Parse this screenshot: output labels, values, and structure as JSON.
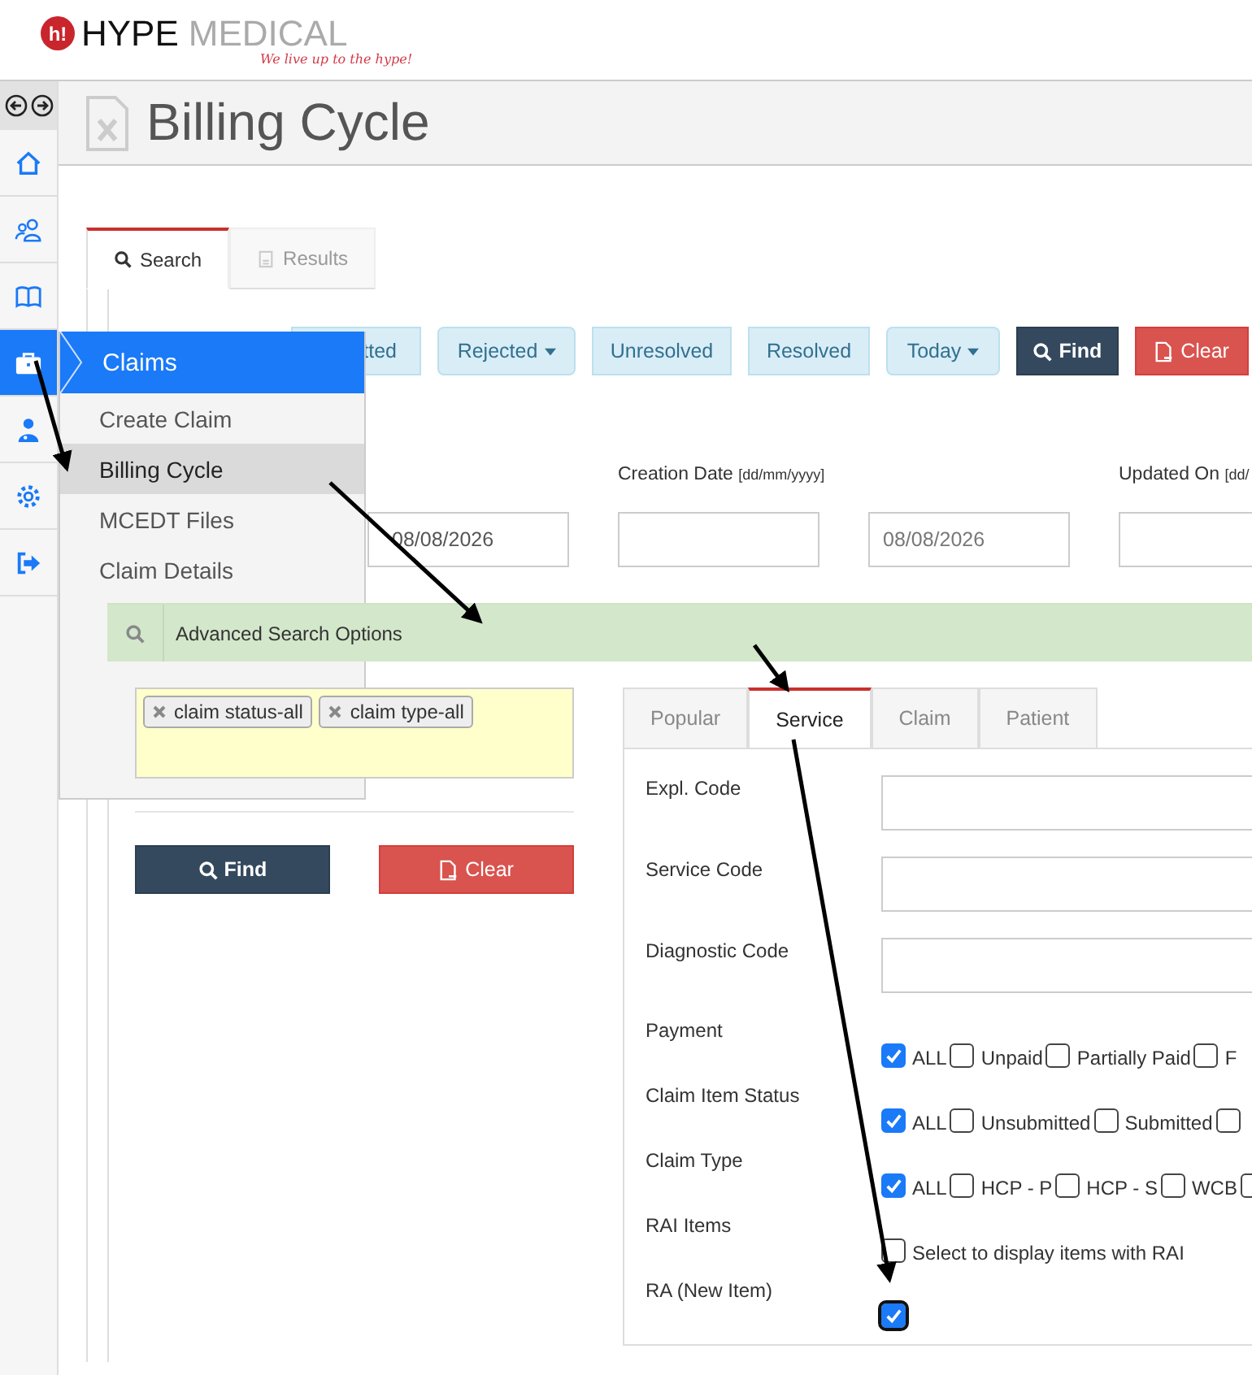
{
  "header": {
    "logo_mark": "h!",
    "brand": "HYPE",
    "brand_suffix": "MEDICAL",
    "tagline": "We live up to the hype!"
  },
  "sidebar": {
    "items": [
      {
        "kind": "home",
        "selected": false
      },
      {
        "kind": "users",
        "selected": false
      },
      {
        "kind": "book",
        "selected": false
      },
      {
        "kind": "briefcase",
        "selected": true
      },
      {
        "kind": "doctor",
        "selected": false
      },
      {
        "kind": "gear",
        "selected": false
      },
      {
        "kind": "signout",
        "selected": false
      }
    ]
  },
  "page_title": "Billing Cycle",
  "tabs": [
    {
      "label": "Search",
      "selected": true,
      "disabled": false
    },
    {
      "label": "Results",
      "selected": false,
      "disabled": true
    }
  ],
  "filter_buttons": [
    {
      "label": "tted",
      "kind": "toggle"
    },
    {
      "label": "Rejected",
      "kind": "dropdown"
    },
    {
      "label": "Unresolved",
      "kind": "toggle"
    },
    {
      "label": "Resolved",
      "kind": "toggle"
    },
    {
      "label": "Today",
      "kind": "dropdown"
    },
    {
      "label": "Find",
      "kind": "find"
    },
    {
      "label": "Clear",
      "kind": "clear"
    }
  ],
  "date_filters": [
    {
      "inputs": [
        {
          "kind": "date",
          "value": "08/08/2026"
        }
      ]
    },
    {
      "label": "Creation Date",
      "hint": "[dd/mm/yyyy]",
      "inputs": [
        {
          "kind": "date"
        },
        {
          "kind": "date",
          "value": "08/08/2026"
        }
      ]
    },
    {
      "label": "Updated On",
      "hint": "[dd/",
      "inputs": [
        {
          "kind": "date"
        }
      ]
    }
  ],
  "menu": {
    "title": "Claims",
    "items": [
      {
        "label": "Create Claim",
        "selected": false
      },
      {
        "label": "Billing Cycle",
        "selected": true
      },
      {
        "label": "MCEDT Files",
        "selected": false
      },
      {
        "label": "Claim Details",
        "selected": false
      }
    ]
  },
  "advanced": {
    "title": "Advanced Search Options",
    "tags": [
      "claim status-all",
      "claim type-all"
    ],
    "buttons": [
      {
        "label": "Find",
        "kind": "find"
      },
      {
        "label": "Clear",
        "kind": "clear"
      }
    ],
    "tabs": [
      {
        "label": "Popular",
        "selected": false
      },
      {
        "label": "Service",
        "selected": true
      },
      {
        "label": "Claim",
        "selected": false
      },
      {
        "label": "Patient",
        "selected": false
      }
    ],
    "rows": [
      {
        "label": "Expl. Code",
        "kind": "text"
      },
      {
        "label": "Service Code",
        "kind": "text"
      },
      {
        "label": "Diagnostic Code",
        "kind": "text"
      },
      {
        "label": "Payment",
        "kind": "checks",
        "options": [
          {
            "label": "ALL",
            "checked": true,
            "focused": false
          },
          {
            "label": "Unpaid",
            "checked": false,
            "focused": false
          },
          {
            "label": "Partially Paid",
            "checked": false,
            "focused": false
          },
          {
            "label": "F",
            "checked": false,
            "focused": false
          }
        ]
      },
      {
        "label": "Claim Item Status",
        "kind": "checks",
        "options": [
          {
            "label": "ALL",
            "checked": true,
            "focused": false
          },
          {
            "label": "Unsubmitted",
            "checked": false,
            "focused": false
          },
          {
            "label": "Submitted",
            "checked": false,
            "focused": false
          },
          {
            "checked": false,
            "focused": false
          }
        ]
      },
      {
        "label": "Claim Type",
        "kind": "checks",
        "options": [
          {
            "label": "ALL",
            "checked": true,
            "focused": false
          },
          {
            "label": "HCP - P",
            "checked": false,
            "focused": false
          },
          {
            "label": "HCP - S",
            "checked": false,
            "focused": false
          },
          {
            "label": "WCB",
            "checked": false,
            "focused": false
          },
          {
            "checked": false,
            "focused": false
          }
        ]
      },
      {
        "label": "RAI Items",
        "kind": "checks",
        "options": [
          {
            "label": "Select to display items with RAI",
            "checked": false,
            "focused": false
          }
        ]
      },
      {
        "label": "RA (New Item)",
        "kind": "checks",
        "options": [
          {
            "checked": true,
            "focused": true
          }
        ]
      }
    ]
  }
}
